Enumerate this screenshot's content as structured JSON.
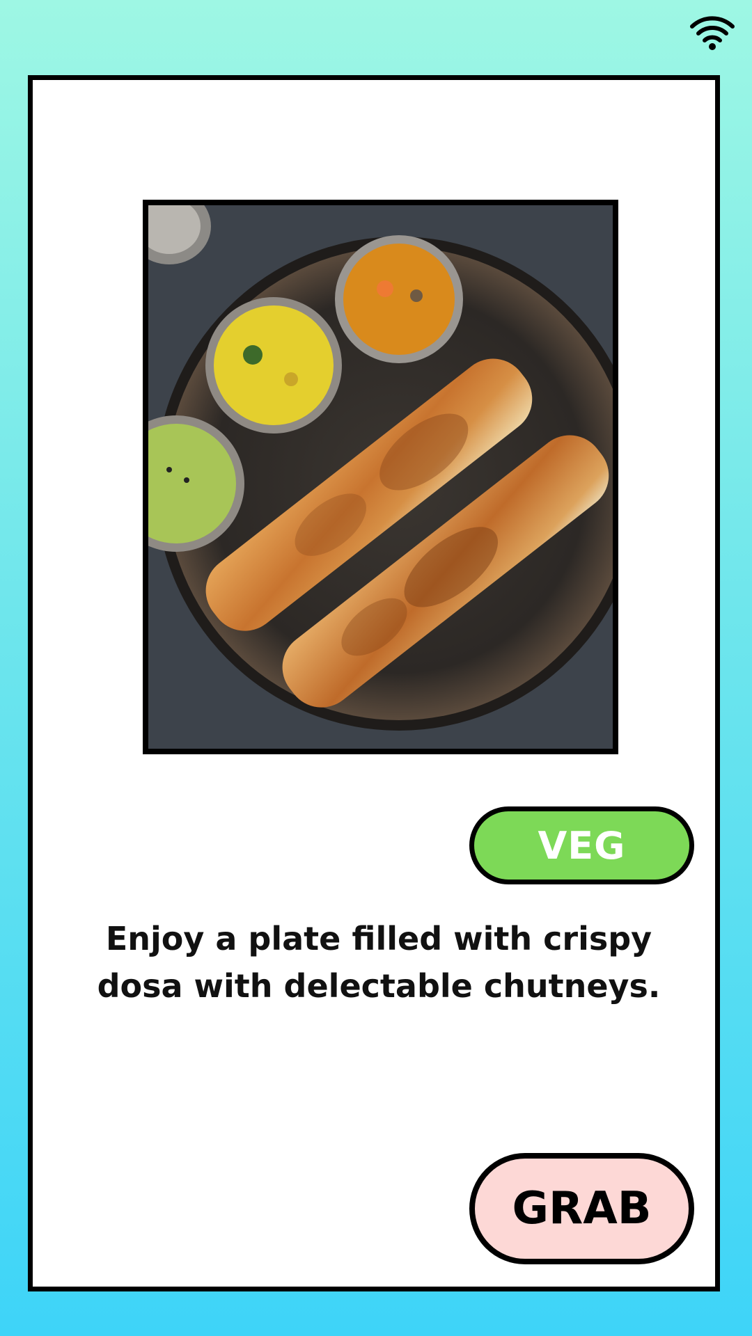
{
  "status_bar": {
    "wifi_icon": "wifi-icon"
  },
  "card": {
    "image_icon": "dosa-plate-photo",
    "badge_label": "VEG",
    "badge_color": "#7dd957",
    "description": "Enjoy a plate filled with crispy\ndosa with  delectable chutneys.",
    "button_label": "GRAB",
    "button_color": "#fdd8d6"
  }
}
